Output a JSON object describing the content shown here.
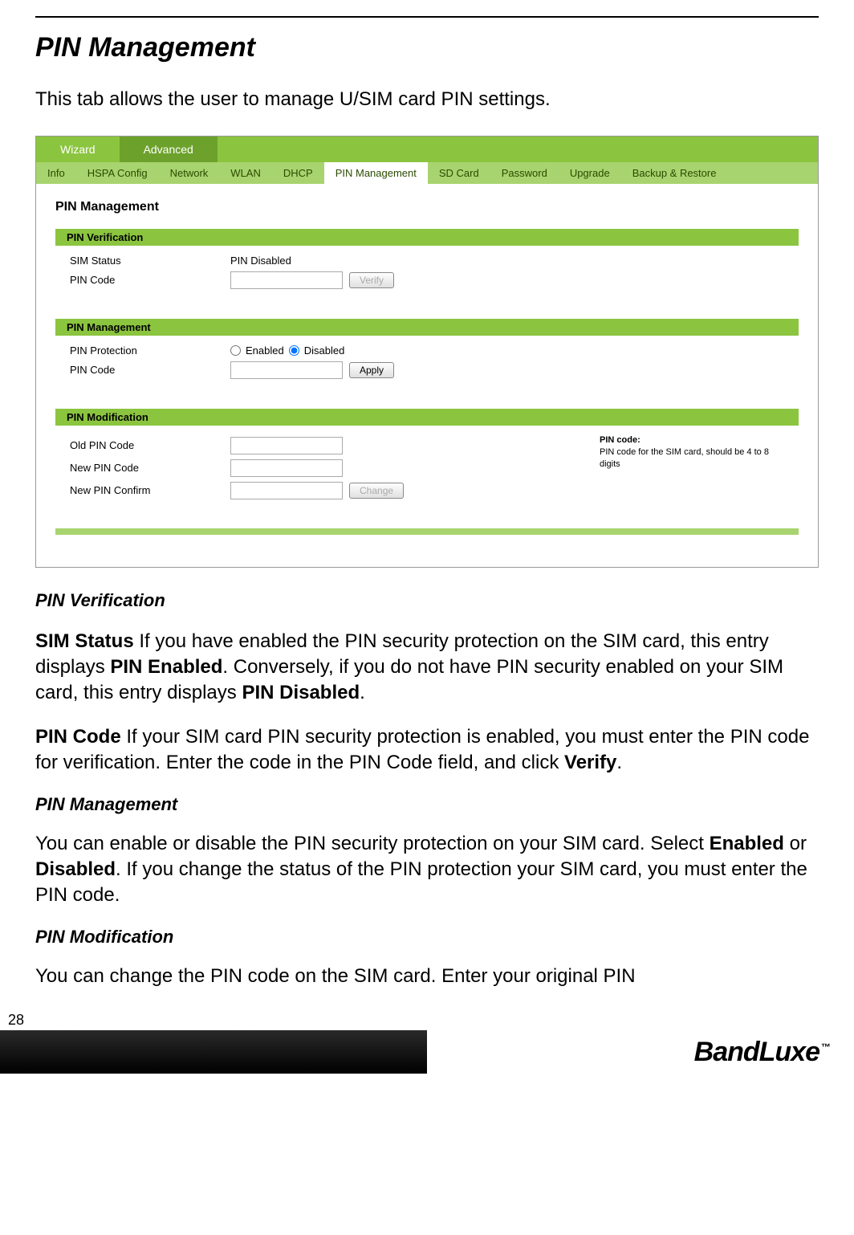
{
  "page_number": "28",
  "heading": "PIN Management",
  "intro": "This tab allows the user to manage U/SIM card PIN settings.",
  "screenshot": {
    "top_tabs": {
      "wizard": "Wizard",
      "advanced": "Advanced"
    },
    "sub_tabs": {
      "info": "Info",
      "hspa": "HSPA Config",
      "network": "Network",
      "wlan": "WLAN",
      "dhcp": "DHCP",
      "pin": "PIN Management",
      "sdcard": "SD Card",
      "password": "Password",
      "upgrade": "Upgrade",
      "backup": "Backup & Restore"
    },
    "panel_title": "PIN Management",
    "sections": {
      "verification": {
        "header": "PIN Verification",
        "sim_status_label": "SIM Status",
        "sim_status_value": "PIN Disabled",
        "pin_code_label": "PIN Code",
        "verify_btn": "Verify"
      },
      "management": {
        "header": "PIN Management",
        "protection_label": "PIN Protection",
        "enabled_label": "Enabled",
        "disabled_label": "Disabled",
        "pin_code_label": "PIN Code",
        "apply_btn": "Apply"
      },
      "modification": {
        "header": "PIN Modification",
        "old_label": "Old PIN Code",
        "new_label": "New PIN Code",
        "confirm_label": "New PIN Confirm",
        "change_btn": "Change",
        "hint_title": "PIN code:",
        "hint_text": "PIN code for the SIM card, should be 4 to 8 digits"
      }
    }
  },
  "doc": {
    "verification_heading": "PIN Verification",
    "sim_status_bold": "SIM Status",
    "sim_status_text_1": " If you have enabled the PIN security protection on the SIM card, this entry displays ",
    "pin_enabled_bold": "PIN Enabled",
    "sim_status_text_2": ". Conversely, if you do not have PIN security enabled on your SIM card, this entry displays ",
    "pin_disabled_bold": "PIN Disabled",
    "sim_status_text_3": ".",
    "pin_code_bold": "PIN Code",
    "pin_code_text_1": " If your SIM card PIN security protection is enabled, you must enter the PIN code for verification. Enter the code in the PIN Code field, and click ",
    "verify_bold": "Verify",
    "pin_code_text_2": ".",
    "management_heading": "PIN Management",
    "management_text_1": "You can enable or disable the PIN security protection on your SIM card. Select ",
    "enabled_bold": "Enabled",
    "management_text_2": " or ",
    "disabled_bold": "Disabled",
    "management_text_3": ". If you change the status of the PIN protection your SIM card, you must enter the PIN code.",
    "modification_heading": "PIN Modification",
    "modification_text": "You can change the PIN code on the SIM card. Enter your original PIN"
  },
  "logo": {
    "text": "BandLuxe",
    "tm": "™"
  }
}
